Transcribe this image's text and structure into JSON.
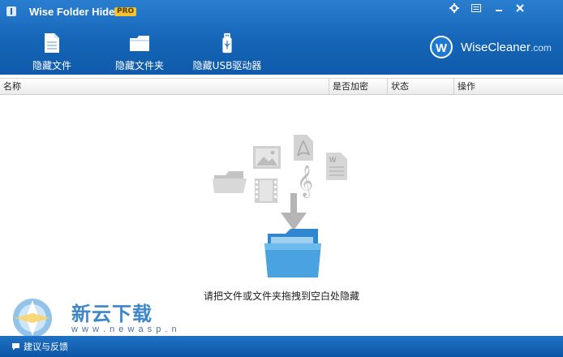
{
  "app": {
    "title": "Wise Folder Hider",
    "badge": "PRO"
  },
  "toolbar": {
    "hide_file": "隐藏文件",
    "hide_folder": "隐藏文件夹",
    "hide_usb": "隐藏USB驱动器"
  },
  "brand": {
    "initial": "W",
    "name": "WiseCleaner",
    "domain": ".com"
  },
  "table": {
    "columns": [
      "名称",
      "是否加密",
      "状态",
      "操作"
    ]
  },
  "dropzone": {
    "hint": "请把文件或文件夹拖拽到空白处隐藏"
  },
  "watermark": {
    "title": "新云下载",
    "url": "w w w . n e w a s p . n e t"
  },
  "statusbar": {
    "feedback": "建议与反馈"
  },
  "icons": {
    "window_controls": [
      "gear-icon",
      "menu-icon",
      "minimize-icon",
      "close-icon"
    ],
    "drop_illustration": [
      "folder-icon",
      "image-icon",
      "pdf-icon",
      "film-icon",
      "music-note-icon",
      "word-doc-icon",
      "arrow-down-icon",
      "open-folder-icon"
    ]
  },
  "colors": {
    "header_blue": "#1565b7",
    "badge_yellow": "#f3c22c",
    "folder_blue": "#4aa3e0"
  }
}
